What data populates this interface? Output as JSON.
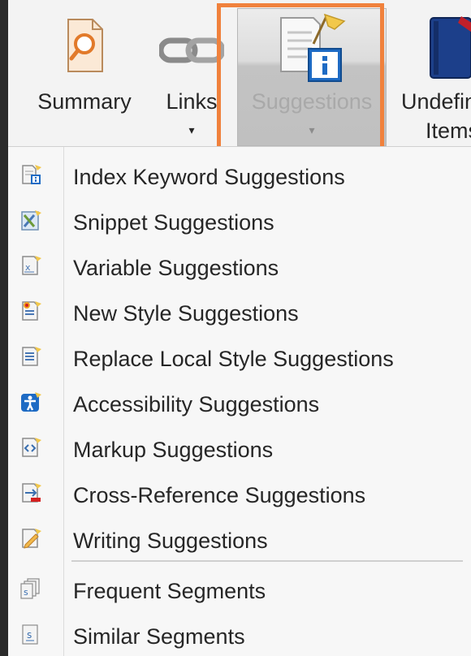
{
  "ribbon": {
    "summary_label": "Summary",
    "links_label": "Links",
    "suggestions_label": "Suggestions",
    "undefined_label_line1": "Undefin",
    "undefined_label_line2": "Items",
    "caret": "▾"
  },
  "menu": {
    "items": [
      {
        "label": "Index Keyword Suggestions",
        "icon": "index-keyword-icon"
      },
      {
        "label": "Snippet Suggestions",
        "icon": "snippet-icon"
      },
      {
        "label": "Variable Suggestions",
        "icon": "variable-icon"
      },
      {
        "label": "New Style Suggestions",
        "icon": "new-style-icon"
      },
      {
        "label": "Replace Local Style Suggestions",
        "icon": "replace-style-icon"
      },
      {
        "label": "Accessibility Suggestions",
        "icon": "accessibility-icon"
      },
      {
        "label": "Markup Suggestions",
        "icon": "markup-icon"
      },
      {
        "label": "Cross-Reference Suggestions",
        "icon": "cross-reference-icon"
      },
      {
        "label": "Writing Suggestions",
        "icon": "writing-icon"
      }
    ],
    "segments": [
      {
        "label": "Frequent Segments",
        "icon": "frequent-segments-icon"
      },
      {
        "label": "Similar Segments",
        "icon": "similar-segments-icon"
      }
    ]
  },
  "colors": {
    "highlight": "#f0813c",
    "accent_blue": "#1e6bc4",
    "flag_yellow": "#f2c84b"
  }
}
